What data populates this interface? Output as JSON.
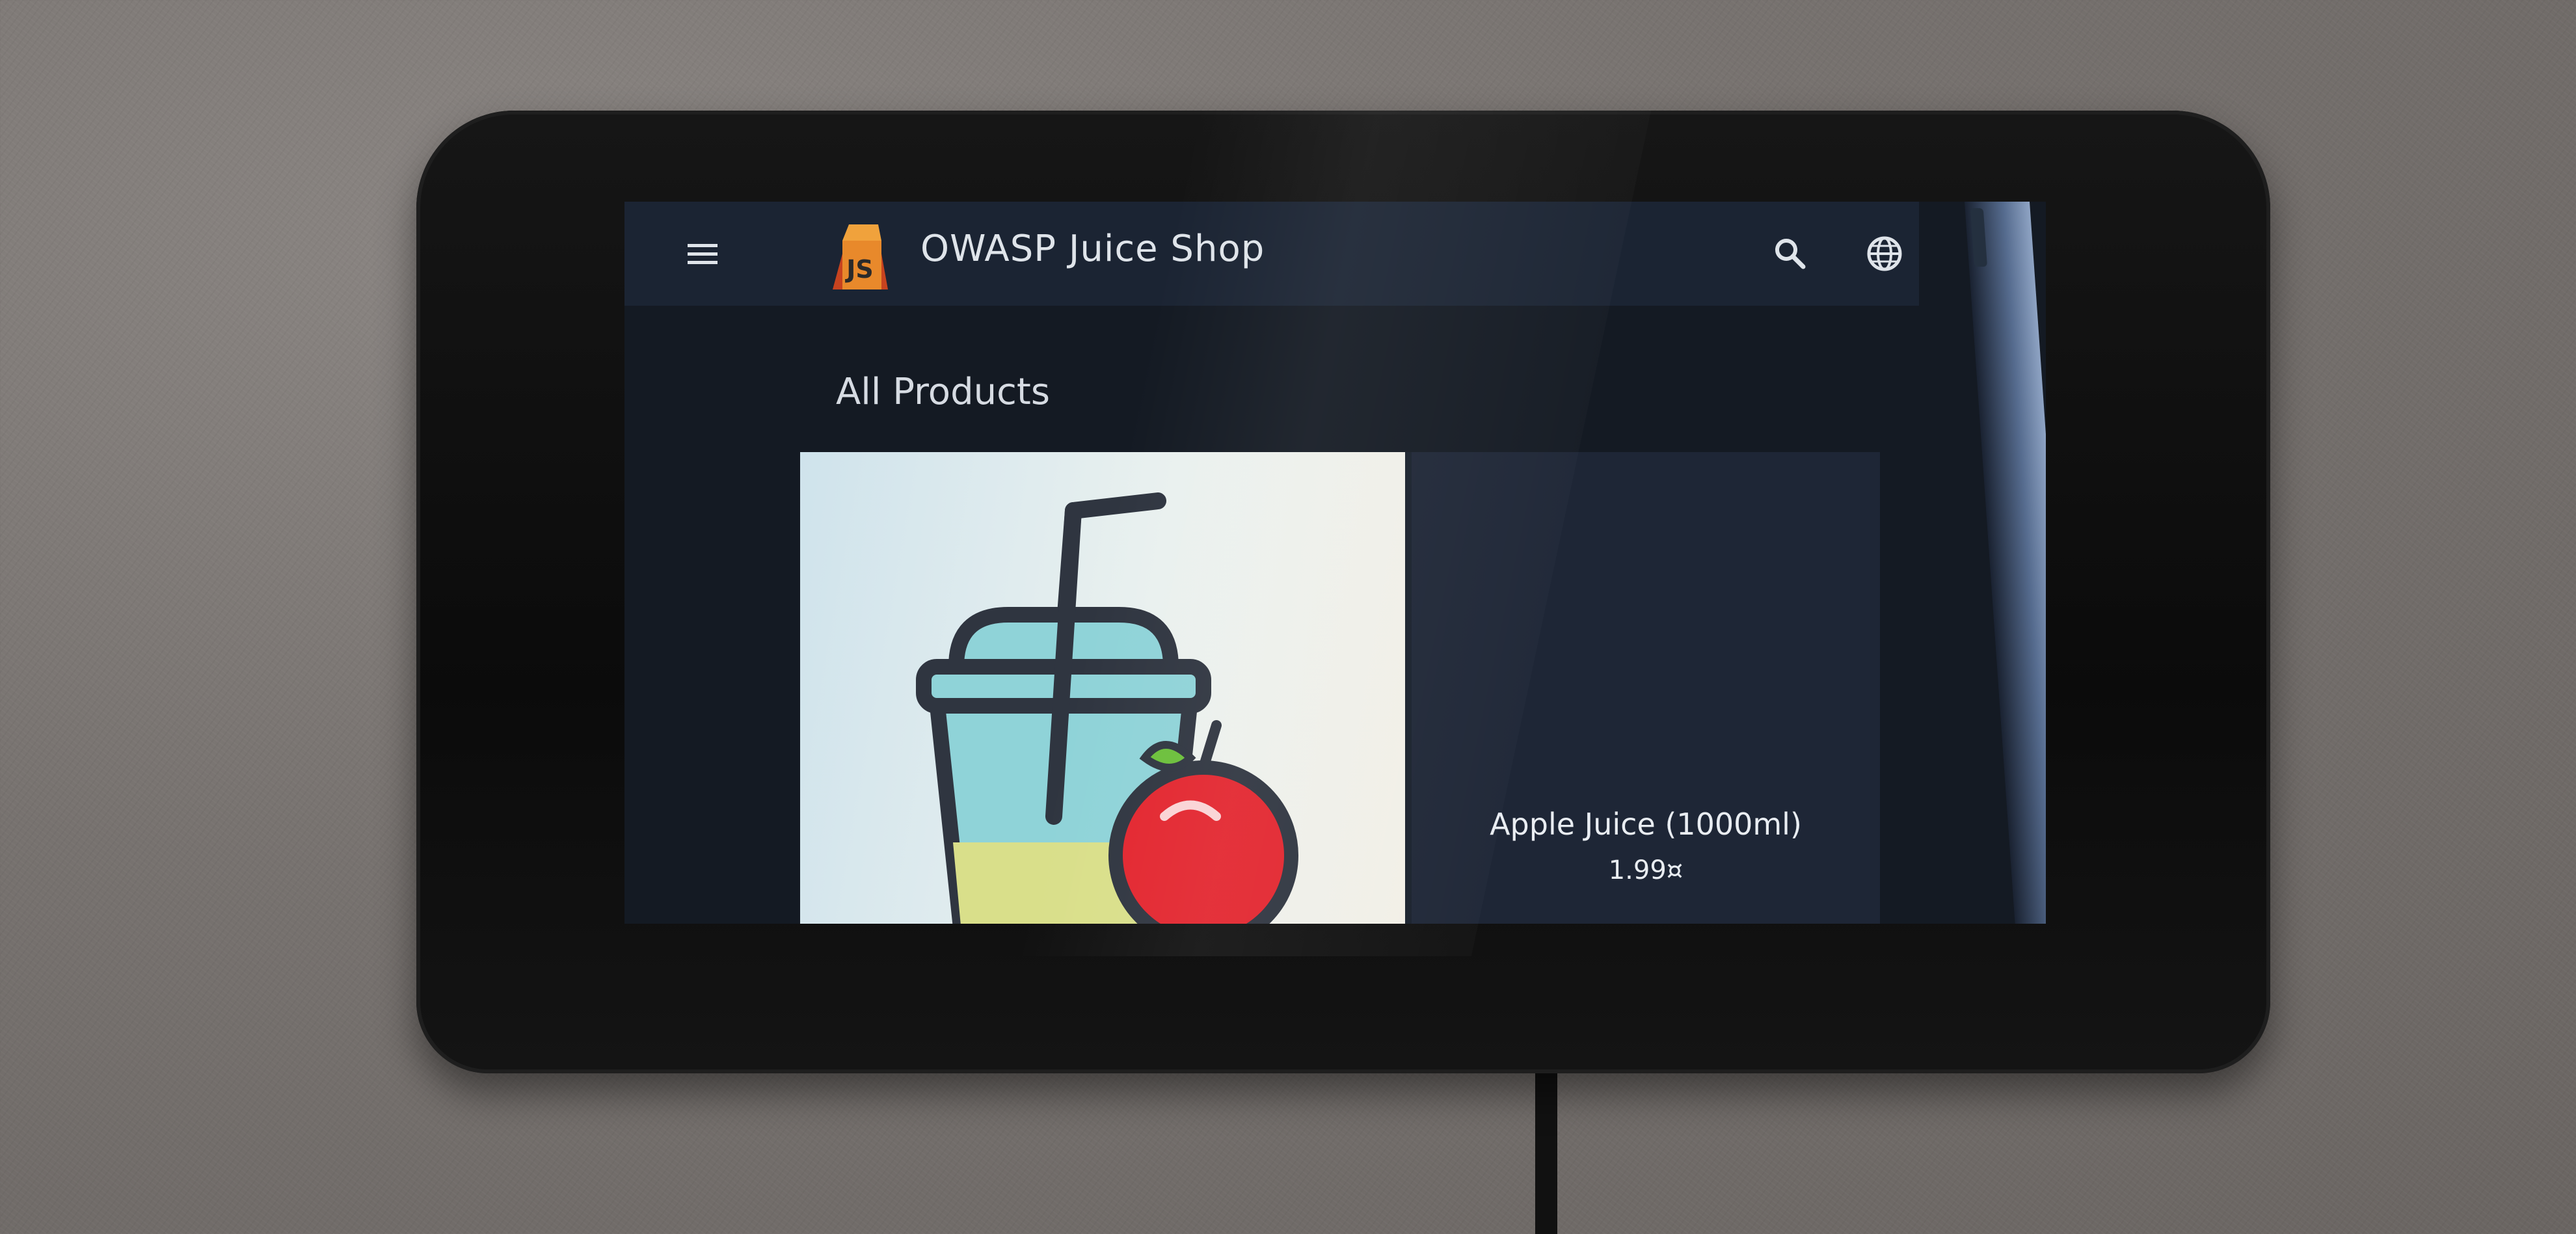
{
  "app": {
    "title": "OWASP Juice Shop",
    "logo_text": "JS"
  },
  "toolbar": {
    "menu_icon": "menu-icon",
    "search_icon": "search-icon",
    "language_icon": "globe-icon"
  },
  "main": {
    "section_title": "All Products",
    "products": [
      {
        "name": "Apple Juice (1000ml)",
        "price": "1.99¤",
        "image_icon": "apple-juice-image"
      }
    ]
  },
  "colors": {
    "toolbar": "#1b2433",
    "background": "#141a23",
    "card": "#1e2636",
    "text": "#e9edf2",
    "apple": "#e3262f",
    "logo_orange": "#e8892b"
  }
}
